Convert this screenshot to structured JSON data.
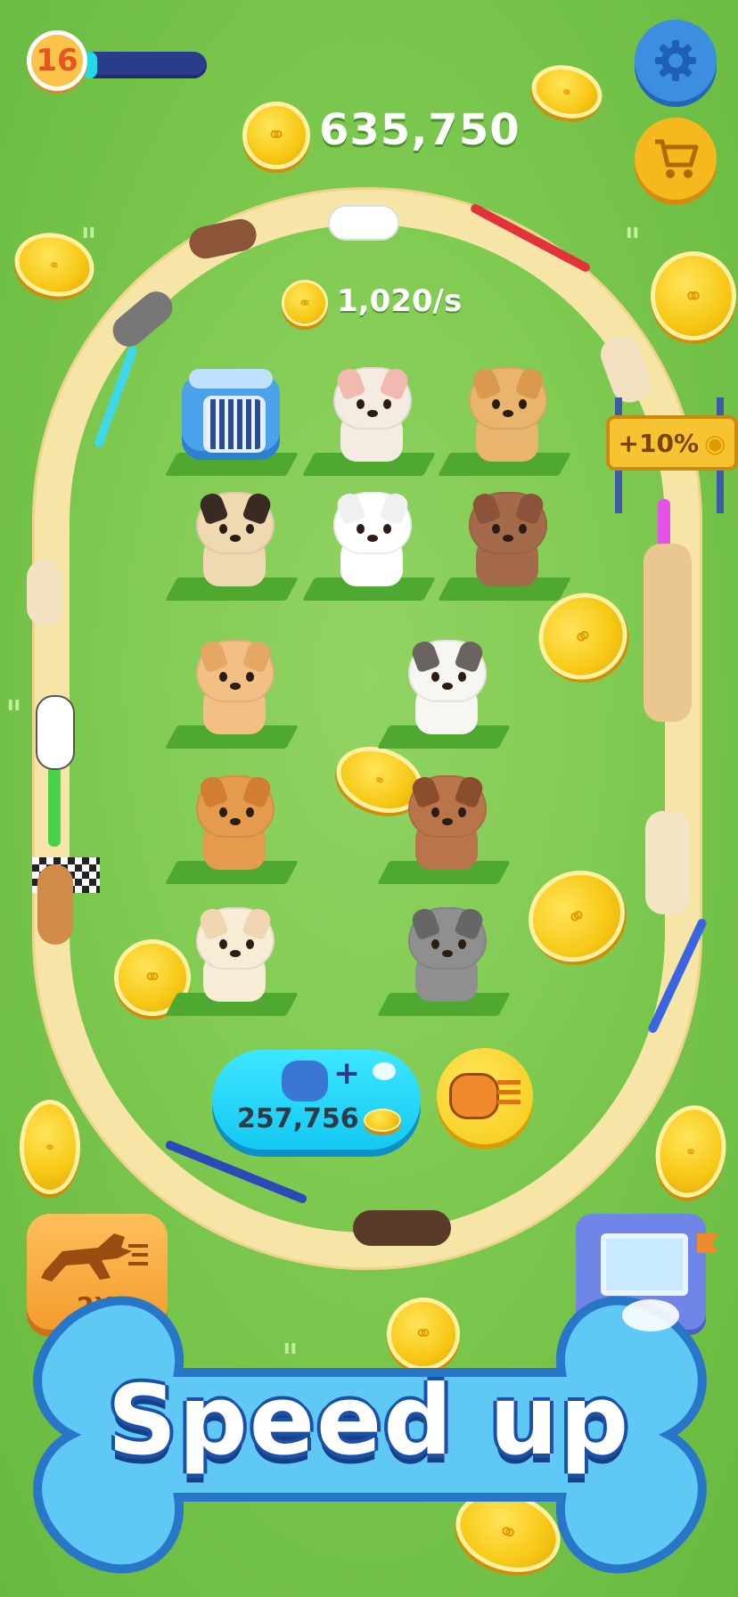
{
  "hud": {
    "level": "16",
    "xp_progress": 0.12,
    "coins": "635,750",
    "rate": "1,020/s"
  },
  "buy_button": {
    "price": "257,756",
    "plus": "+"
  },
  "track_gate": {
    "bonus": "+10%"
  },
  "speed_button": {
    "label": "2X"
  },
  "banner": {
    "text": "Speed up"
  },
  "grid": [
    {
      "kind": "crate",
      "name": "carrier"
    },
    {
      "kind": "dog",
      "name": "french-bulldog",
      "fur": "#f4ece3",
      "ear": "#f2b9b0"
    },
    {
      "kind": "dog",
      "name": "golden-retriever",
      "fur": "#e9b56e",
      "ear": "#d99a4e"
    },
    {
      "kind": "dog",
      "name": "pug",
      "fur": "#eed9b3",
      "ear": "#3a2a22"
    },
    {
      "kind": "dog",
      "name": "maltese",
      "fur": "#ffffff",
      "ear": "#f0f0f0"
    },
    {
      "kind": "dog",
      "name": "poodle",
      "fur": "#a56a4a",
      "ear": "#8b5339"
    },
    {
      "kind": "dog",
      "name": "shiba-inu",
      "fur": "#f2bf85",
      "ear": "#e4a765"
    },
    {
      "kind": "dog",
      "name": "bull-terrier",
      "fur": "#f8f6f1",
      "ear": "#6a6460"
    },
    {
      "kind": "dog",
      "name": "corgi",
      "fur": "#e59b4e",
      "ear": "#d27e32"
    },
    {
      "kind": "dog",
      "name": "beagle",
      "fur": "#b9744a",
      "ear": "#8a4e2c"
    },
    {
      "kind": "dog",
      "name": "labrador",
      "fur": "#f7ecd6",
      "ear": "#efd6b0"
    },
    {
      "kind": "dog",
      "name": "schnauzer",
      "fur": "#8f8f8f",
      "ear": "#666666"
    }
  ],
  "colors": {
    "grass": "#7cc84f",
    "track": "#f7e5a8",
    "accent_blue": "#3c8fe0",
    "coin": "#f7c815"
  }
}
